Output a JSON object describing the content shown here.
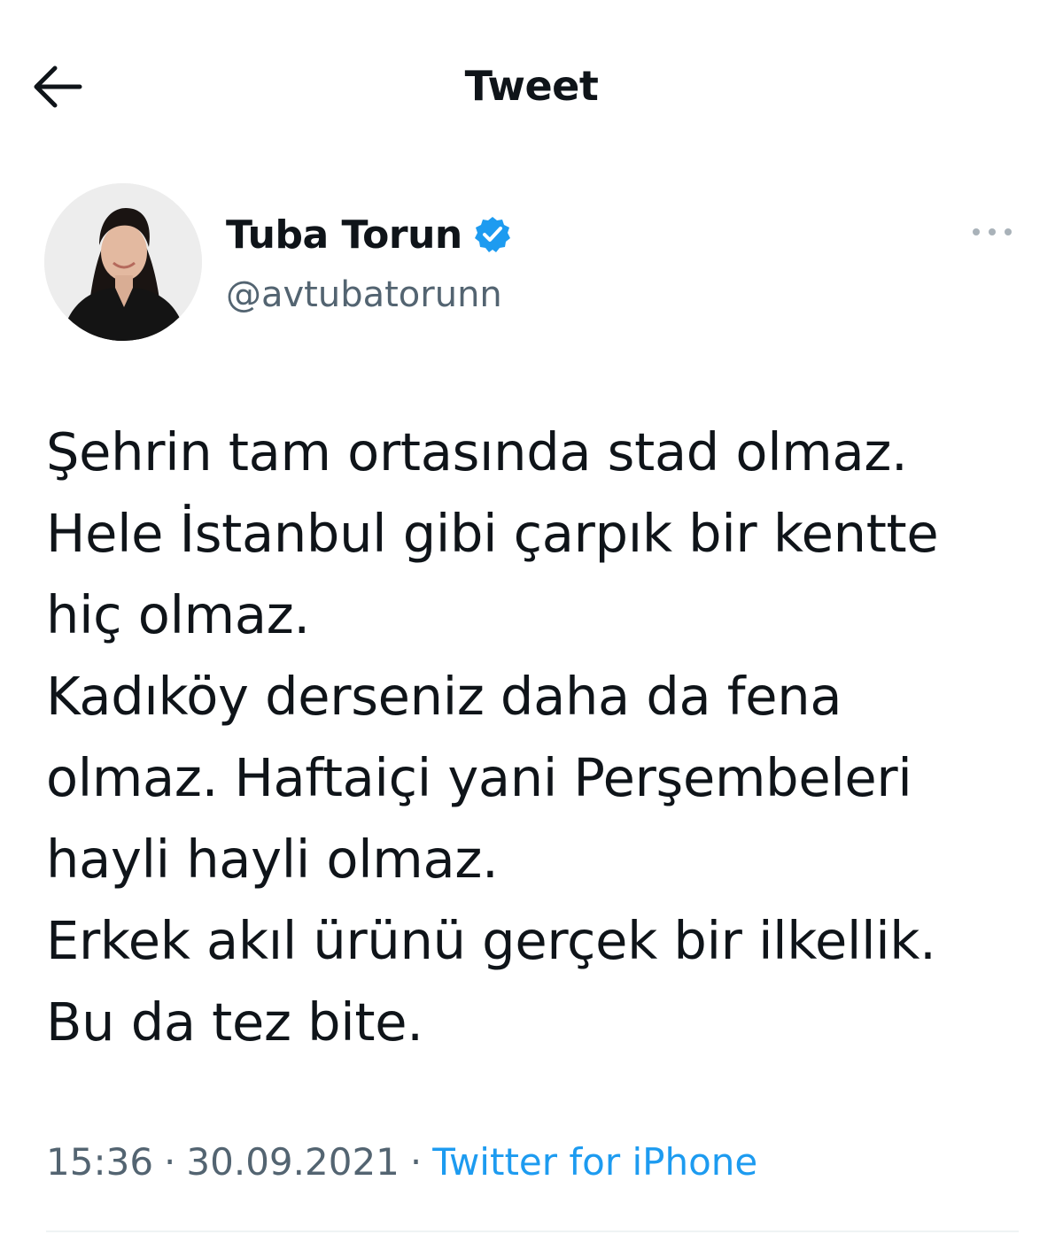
{
  "header": {
    "title": "Tweet",
    "back_icon": "arrow-left-icon"
  },
  "author": {
    "display_name": "Tuba Torun",
    "handle": "@avtubatorunn",
    "verified_icon": "verified-badge-icon",
    "more_icon": "more-horizontal-icon"
  },
  "tweet": {
    "text": "Şehrin tam ortasında stad olmaz.\nHele İstanbul gibi çarpık bir kentte\nhiç olmaz.\nKadıköy derseniz daha da fena\nolmaz. Haftaiçi yani Perşembeleri\nhayli hayli olmaz.\nErkek akıl ürünü gerçek bir ilkellik.\nBu da tez bite.",
    "time": "15:36",
    "separator": "·",
    "date": "30.09.2021",
    "source": "Twitter for iPhone"
  },
  "colors": {
    "text": "#0f1419",
    "secondary": "#536471",
    "link": "#1d9bf0",
    "verified": "#1d9bf0",
    "divider": "#eff3f4"
  }
}
